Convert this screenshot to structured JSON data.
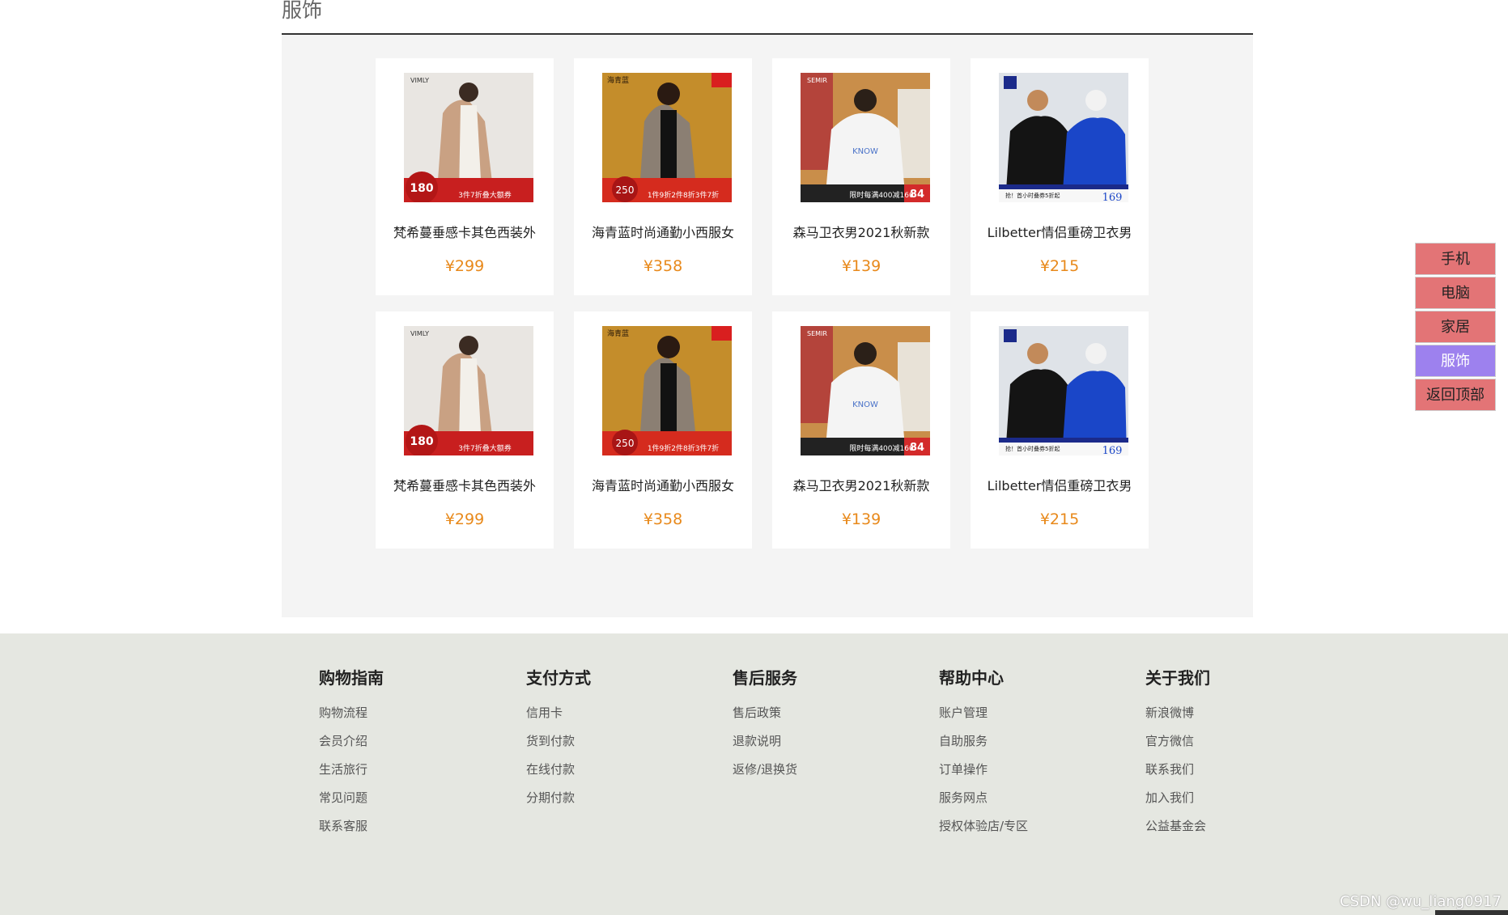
{
  "section": {
    "title": "服饰"
  },
  "products": [
    {
      "name": "梵希蔓垂感卡其色西装外",
      "price": "¥299",
      "image": "beige-blazer",
      "banner": "3件7折叠大额券",
      "badge": "180"
    },
    {
      "name": "海青蓝时尚通勤小西服女",
      "price": "¥358",
      "image": "plaid-blazer",
      "banner": "1件9折2件8折3件7折",
      "badge": "250"
    },
    {
      "name": "森马卫衣男2021秋新款",
      "price": "¥139",
      "image": "white-sweatshirt",
      "banner": "限时每满400减160",
      "badge": "84"
    },
    {
      "name": "Lilbetter情侣重磅卫衣男",
      "price": "¥215",
      "image": "couple-hoodies",
      "banner": "抢！首小时叠券5折起",
      "badge": "169"
    },
    {
      "name": "梵希蔓垂感卡其色西装外",
      "price": "¥299",
      "image": "beige-blazer",
      "banner": "3件7折叠大额券",
      "badge": "180"
    },
    {
      "name": "海青蓝时尚通勤小西服女",
      "price": "¥358",
      "image": "plaid-blazer",
      "banner": "1件9折2件8折3件7折",
      "badge": "250"
    },
    {
      "name": "森马卫衣男2021秋新款",
      "price": "¥139",
      "image": "white-sweatshirt",
      "banner": "限时每满400减160",
      "badge": "84"
    },
    {
      "name": "Lilbetter情侣重磅卫衣男",
      "price": "¥215",
      "image": "couple-hoodies",
      "banner": "抢！首小时叠券5折起",
      "badge": "169"
    }
  ],
  "footer": {
    "columns": [
      {
        "title": "购物指南",
        "links": [
          "购物流程",
          "会员介绍",
          "生活旅行",
          "常见问题",
          "联系客服"
        ]
      },
      {
        "title": "支付方式",
        "links": [
          "信用卡",
          "货到付款",
          "在线付款",
          "分期付款"
        ]
      },
      {
        "title": "售后服务",
        "links": [
          "售后政策",
          "退款说明",
          "返修/退换货"
        ]
      },
      {
        "title": "帮助中心",
        "links": [
          "账户管理",
          "自助服务",
          "订单操作",
          "服务网点",
          "授权体验店/专区"
        ]
      },
      {
        "title": "关于我们",
        "links": [
          "新浪微博",
          "官方微信",
          "联系我们",
          "加入我们",
          "公益基金会"
        ]
      }
    ]
  },
  "sidenav": {
    "items": [
      "手机",
      "电脑",
      "家居",
      "服饰",
      "返回顶部"
    ],
    "active": "服饰"
  },
  "watermark": "CSDN @wu_liang0917",
  "colors": {
    "price": "#e8891b",
    "nav_item": "#e37476",
    "nav_active": "#9d81ee",
    "footer_bg": "#e5e7e1",
    "panel_bg": "#f4f4f4"
  }
}
